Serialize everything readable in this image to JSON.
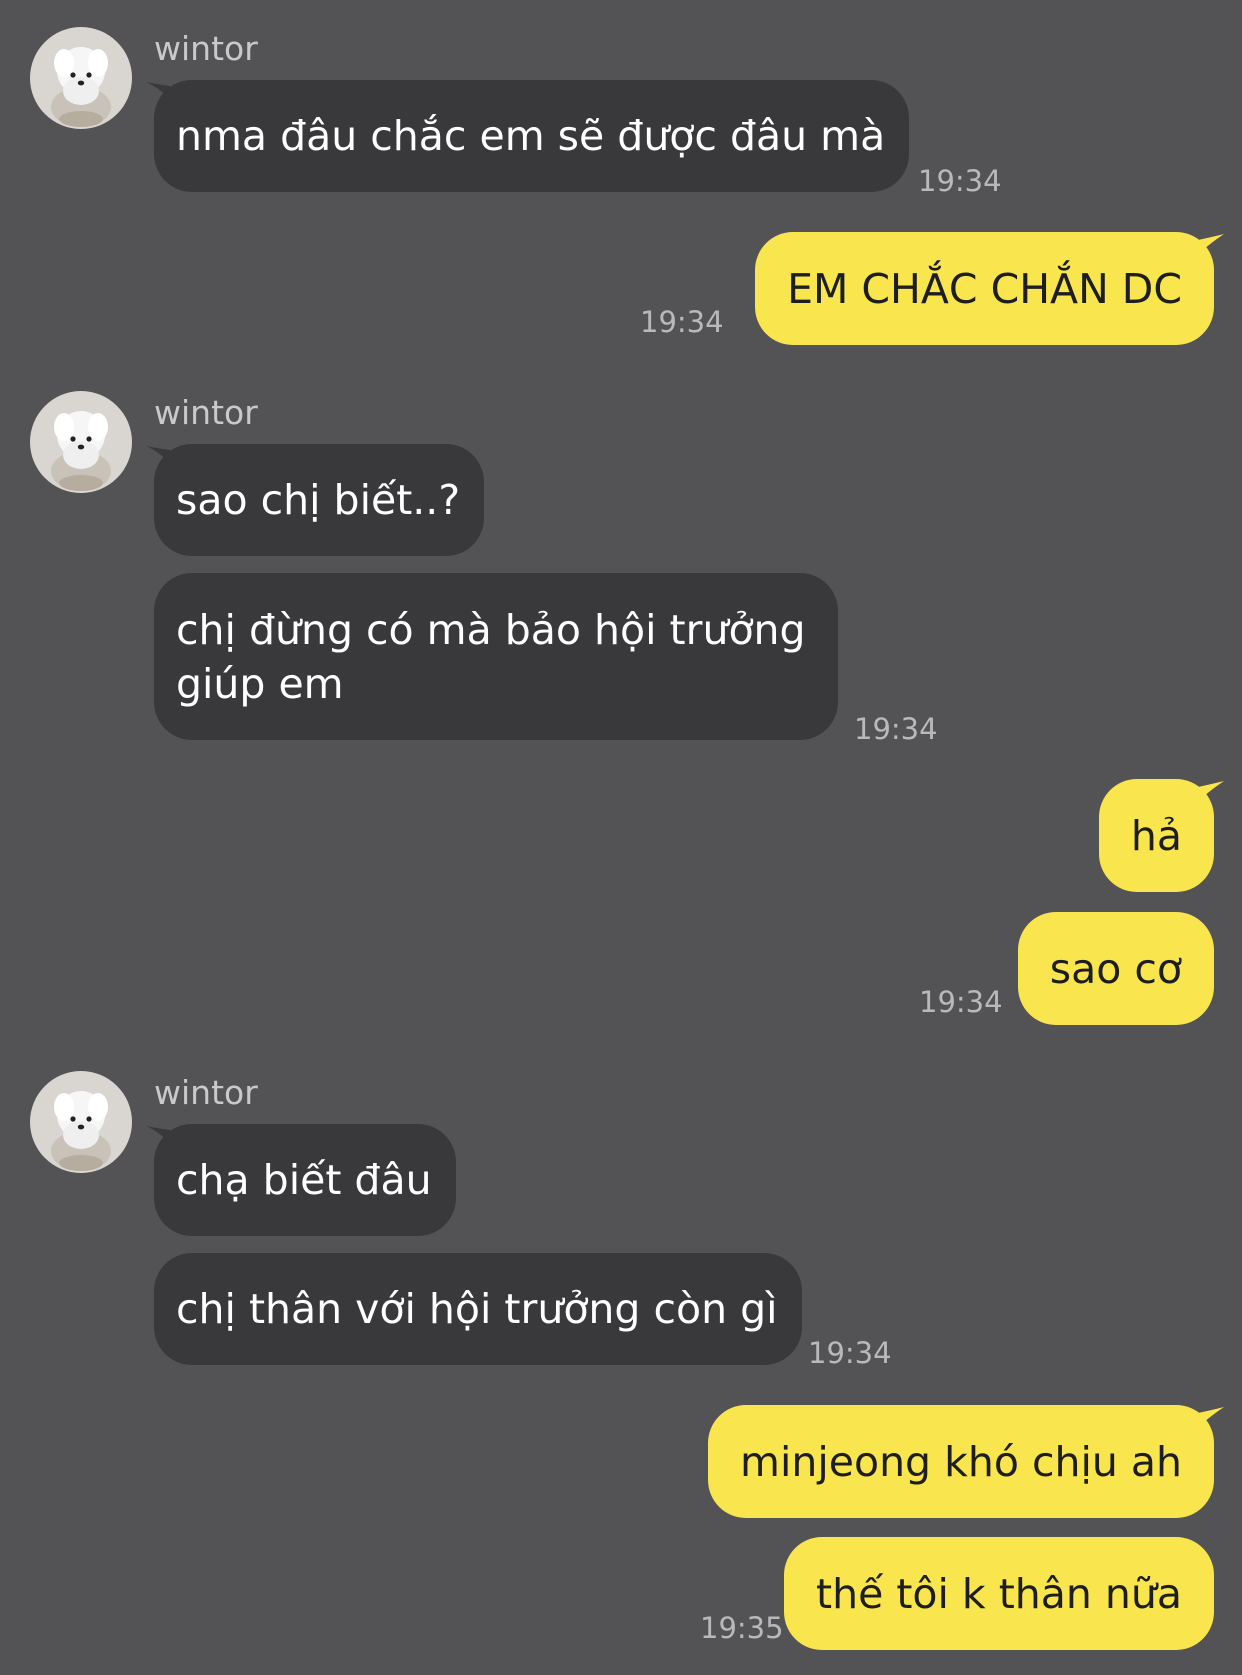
{
  "colors": {
    "background": "#535254",
    "incoming_bubble": "#39383a",
    "outgoing_bubble": "#f9e54d"
  },
  "contact": {
    "name": "wintor",
    "avatar_icon": "white-dog-avatar-icon"
  },
  "messages": [
    {
      "from": "contact",
      "sender": "wintor",
      "text": "nma đâu chắc em sẽ được đâu mà",
      "time": "19:34"
    },
    {
      "from": "me",
      "text": "EM CHẮC CHẮN DC",
      "time": "19:34"
    },
    {
      "from": "contact",
      "sender": "wintor",
      "text": "sao chị biết..?",
      "time": ""
    },
    {
      "from": "contact",
      "text": "chị đừng có mà bảo hội trưởng giúp em",
      "time": "19:34"
    },
    {
      "from": "me",
      "text": "hả",
      "time": ""
    },
    {
      "from": "me",
      "text": "sao cơ",
      "time": "19:34"
    },
    {
      "from": "contact",
      "sender": "wintor",
      "text": "chạ biết đâu",
      "time": ""
    },
    {
      "from": "contact",
      "text": "chị thân với hội trưởng còn gì",
      "time": "19:34"
    },
    {
      "from": "me",
      "text": "minjeong khó chịu ah",
      "time": ""
    },
    {
      "from": "me",
      "text": "thế tôi k thân nữa",
      "time": "19:35"
    }
  ]
}
